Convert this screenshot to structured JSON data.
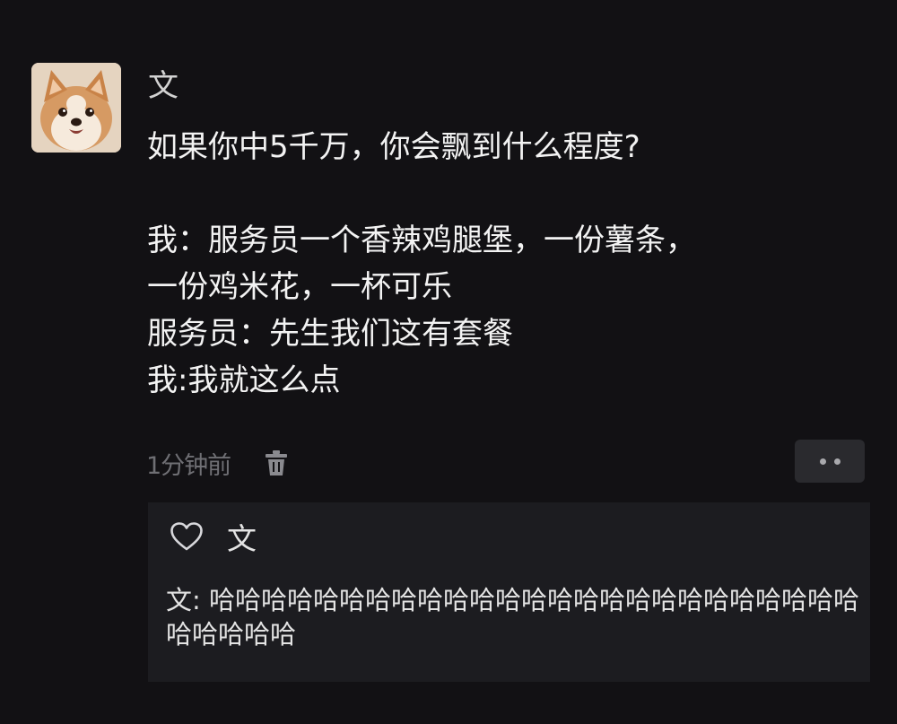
{
  "post": {
    "author": "文",
    "avatar_icon": "shiba-dog-avatar",
    "lines": [
      "如果你中5千万，你会飘到什么程度?",
      "",
      "我：服务员一个香辣鸡腿堡，一份薯条，",
      "一份鸡米花，一杯可乐",
      "服务员：先生我们这有套餐",
      "我:我就这么点"
    ],
    "time": "1分钟前",
    "delete_icon": "trash-icon",
    "more_icon": "more-dots-icon"
  },
  "interactions": {
    "like_icon": "heart-icon",
    "liked_by": "文",
    "comment_author": "文",
    "comment_sep": ": ",
    "comment_text": "哈哈哈哈哈哈哈哈哈哈哈哈哈哈哈哈哈哈哈哈哈哈哈哈哈哈哈哈哈哈"
  },
  "colors": {
    "background": "#121114",
    "comment_panel": "#1c1c20",
    "text": "#f3f3f3",
    "muted": "#6f6f74"
  }
}
